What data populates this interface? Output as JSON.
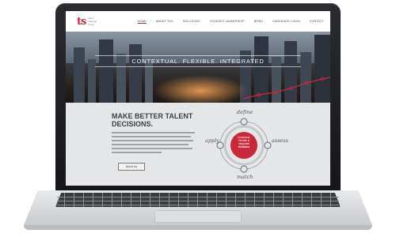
{
  "site": {
    "logo_text": "ts",
    "logo_sub": "talent strategy group",
    "nav": [
      "Home",
      "About TSG",
      "Solutions",
      "Thought Leadership",
      "News",
      "Candidate Login",
      "Contact"
    ]
  },
  "hero": {
    "title": "Contextual. Flexible. Integrated"
  },
  "section": {
    "headline_line1": "Make Better Talent",
    "headline_line2": "Decisions.",
    "button": "About Us"
  },
  "diagram": {
    "top": "define",
    "left": "apply",
    "right": "assess",
    "bottom": "match",
    "center_line1": "Contextual,",
    "center_line2": "Flexible &",
    "center_line3": "Integrated",
    "center_line4": "Solutions"
  },
  "colors": {
    "accent": "#c8283a",
    "navy": "#0d1d3d",
    "panel": "#e5e6e8"
  }
}
